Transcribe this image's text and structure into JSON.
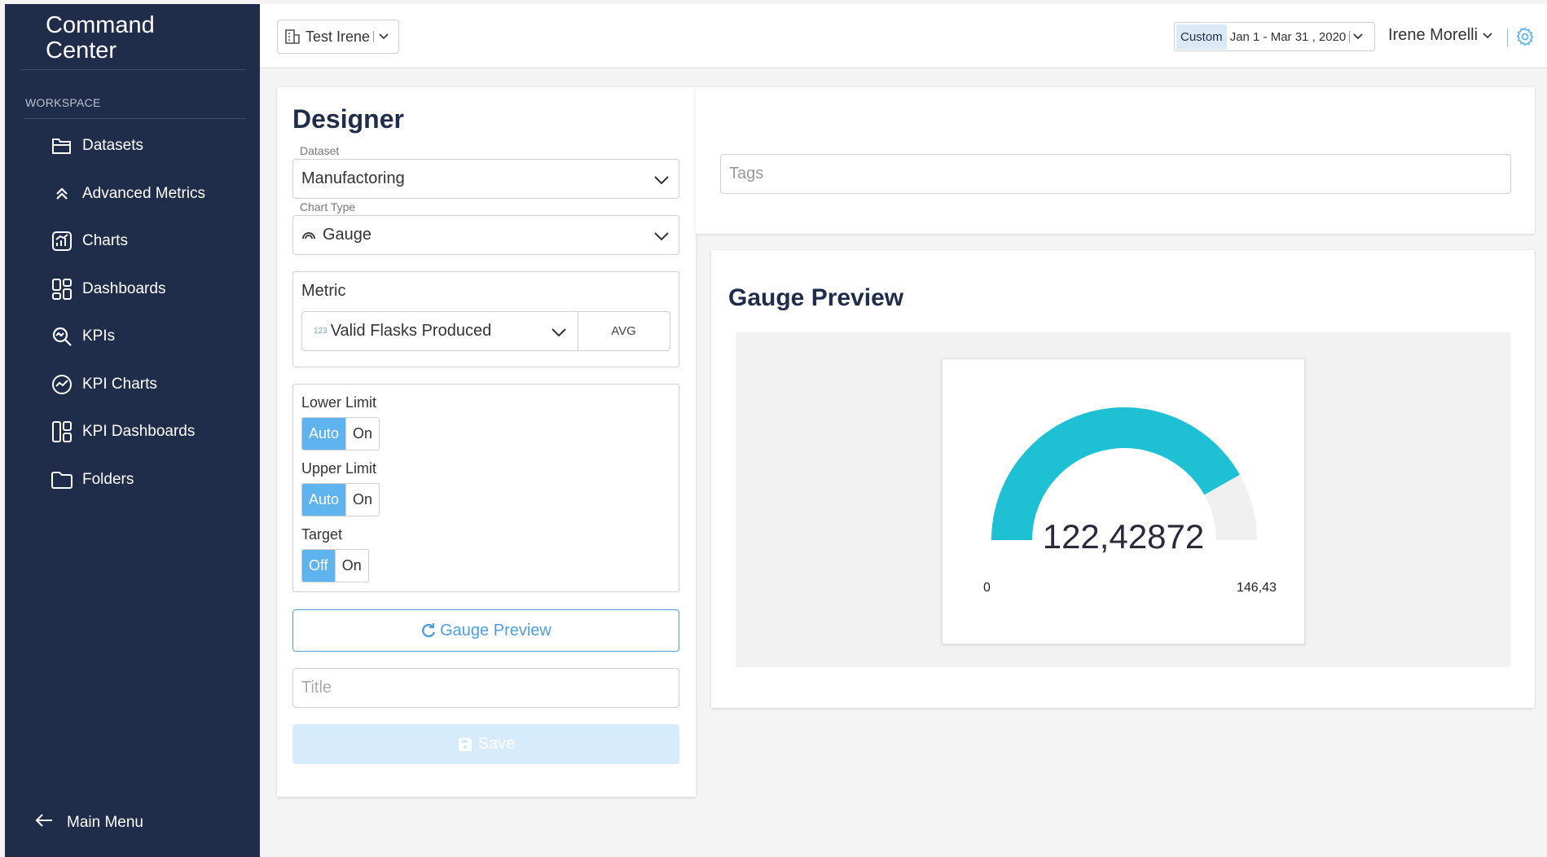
{
  "brand": {
    "line1": "Command",
    "line2": "Center"
  },
  "sidebar": {
    "section_label": "WORKSPACE",
    "items": [
      {
        "label": "Datasets",
        "icon": "folder-open-icon"
      },
      {
        "label": "Advanced Metrics",
        "icon": "chevrons-up-icon"
      },
      {
        "label": "Charts",
        "icon": "chart-icon"
      },
      {
        "label": "Dashboards",
        "icon": "dashboard-icon"
      },
      {
        "label": "KPIs",
        "icon": "kpi-search-icon"
      },
      {
        "label": "KPI Charts",
        "icon": "kpi-chart-icon"
      },
      {
        "label": "KPI Dashboards",
        "icon": "kpi-dashboard-icon"
      },
      {
        "label": "Folders",
        "icon": "folder-icon"
      }
    ],
    "main_menu": "Main Menu"
  },
  "topbar": {
    "org": "Test Irene",
    "date_badge": "Custom",
    "date_range": "Jan 1 - Mar 31 , 2020",
    "user": "Irene Morelli"
  },
  "designer": {
    "title": "Designer",
    "dataset_label": "Dataset",
    "dataset_value": "Manufactoring",
    "chart_type_label": "Chart Type",
    "chart_type_value": "Gauge",
    "metric_label": "Metric",
    "metric_type_badge": "123",
    "metric_value": "Valid Flasks Produced",
    "aggregation": "AVG",
    "lower_limit": {
      "label": "Lower Limit",
      "active": "Auto",
      "other": "On"
    },
    "upper_limit": {
      "label": "Upper Limit",
      "active": "Auto",
      "other": "On"
    },
    "target": {
      "label": "Target",
      "active": "Off",
      "other": "On"
    },
    "preview_button": "Gauge Preview",
    "title_placeholder": "Title",
    "save_button": "Save"
  },
  "tags": {
    "placeholder": "Tags"
  },
  "preview": {
    "title": "Gauge Preview"
  },
  "chart_data": {
    "type": "gauge",
    "value_label": "122,42872",
    "value": 122.42872,
    "min_label": "0",
    "max_label": "146,43",
    "min": 0,
    "max": 146.43,
    "fill_color": "#1ec0d4",
    "track_color": "#f0f0f0"
  },
  "colors": {
    "sidebar_bg": "#1f2d4b",
    "accent": "#5fb3ee",
    "heading": "#1f2d4b"
  }
}
